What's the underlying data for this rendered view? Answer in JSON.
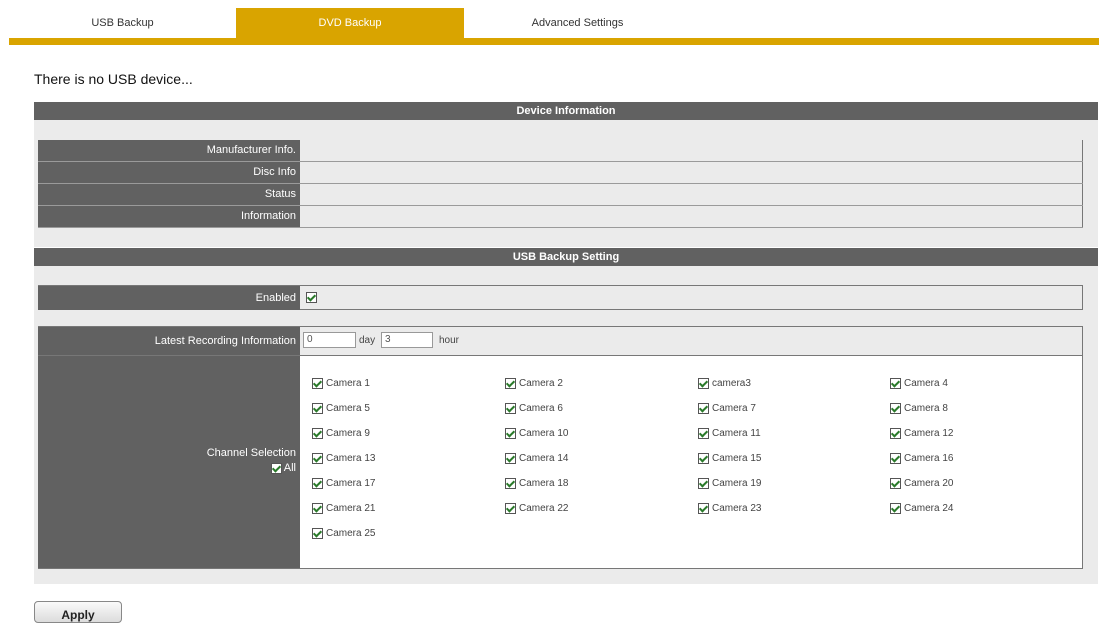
{
  "tabs": [
    {
      "label": "USB Backup",
      "active": false
    },
    {
      "label": "DVD Backup",
      "active": true
    },
    {
      "label": "Advanced Settings",
      "active": false
    }
  ],
  "status_message": "There is no USB device...",
  "device_info": {
    "title": "Device Information",
    "rows": [
      {
        "label": "Manufacturer Info.",
        "value": ""
      },
      {
        "label": "Disc Info",
        "value": ""
      },
      {
        "label": "Status",
        "value": ""
      },
      {
        "label": "Information",
        "value": ""
      }
    ]
  },
  "backup_setting": {
    "title": "USB Backup Setting",
    "enabled_label": "Enabled",
    "enabled": true,
    "latest_recording_label": "Latest Recording Information",
    "day_value": "0",
    "day_unit": "day",
    "hour_value": "3",
    "hour_unit": "hour",
    "channel_selection_label": "Channel Selection",
    "all_label": "All",
    "all_checked": true,
    "cameras": [
      "Camera 1",
      "Camera 2",
      "camera3",
      "Camera 4",
      "Camera 5",
      "Camera 6",
      "Camera 7",
      "Camera 8",
      "Camera 9",
      "Camera 10",
      "Camera 11",
      "Camera 12",
      "Camera 13",
      "Camera 14",
      "Camera 15",
      "Camera 16",
      "Camera 17",
      "Camera 18",
      "Camera 19",
      "Camera 20",
      "Camera 21",
      "Camera 22",
      "Camera 23",
      "Camera 24",
      "Camera 25"
    ]
  },
  "apply_label": "Apply",
  "colors": {
    "accent": "#d9a400",
    "header": "#616161",
    "panel": "#ebebeb"
  }
}
